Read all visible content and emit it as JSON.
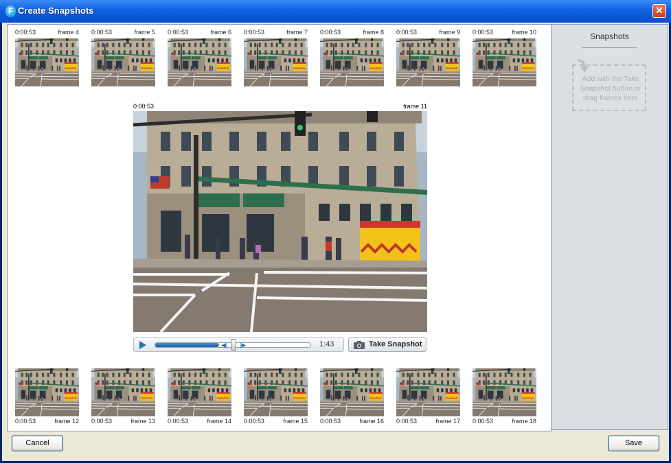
{
  "window": {
    "title": "Create Snapshots",
    "icon_glyph": "F"
  },
  "close_glyph": "✕",
  "top_frames": [
    {
      "time": "0:00:53",
      "label": "frame 4"
    },
    {
      "time": "0:00:53",
      "label": "frame 5"
    },
    {
      "time": "0:00:53",
      "label": "frame 6"
    },
    {
      "time": "0:00:53",
      "label": "frame 7"
    },
    {
      "time": "0:00:53",
      "label": "frame 8"
    },
    {
      "time": "0:00:53",
      "label": "frame 9"
    },
    {
      "time": "0:00:53",
      "label": "frame 10"
    }
  ],
  "current_frame": {
    "time": "0:00:53",
    "label": "frame 11"
  },
  "bottom_frames": [
    {
      "time": "0:00:53",
      "label": "frame 12"
    },
    {
      "time": "0:00:53",
      "label": "frame 13"
    },
    {
      "time": "0:00:53",
      "label": "frame 14"
    },
    {
      "time": "0:00:53",
      "label": "frame 15"
    },
    {
      "time": "0:00:53",
      "label": "frame 16"
    },
    {
      "time": "0:00:53",
      "label": "frame 17"
    },
    {
      "time": "0:00:53",
      "label": "frame 18"
    }
  ],
  "player": {
    "duration": "1:43",
    "progress": 0.41,
    "step_back_glyph": "◀|",
    "step_forward_glyph": "|▶"
  },
  "take_snapshot_label": "Take Snapshot",
  "snapshots_panel": {
    "title": "Snapshots",
    "hint": "Add with the Take Snapshot button or drag frames here"
  },
  "buttons": {
    "cancel": "Cancel",
    "save": "Save"
  },
  "colors": {
    "titlebar": "#0f5fe0",
    "accent": "#2a6fb3"
  }
}
